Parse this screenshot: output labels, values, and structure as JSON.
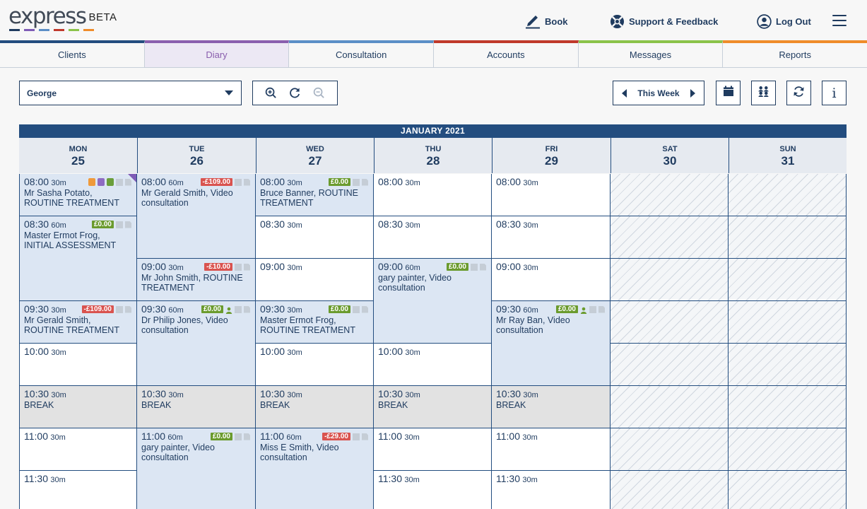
{
  "app": {
    "logo": "express",
    "beta": "BETA",
    "logo_colors": [
      "#1f3b5f",
      "#7e5bb6",
      "#5b8fc7",
      "#c0392b",
      "#8bc34a",
      "#ef8c2a"
    ]
  },
  "header": {
    "book": "Book",
    "support": "Support & Feedback",
    "logout": "Log Out"
  },
  "tabs": [
    {
      "label": "Clients",
      "color": "#234d7f"
    },
    {
      "label": "Diary",
      "color": "#8a5fae"
    },
    {
      "label": "Consultation",
      "color": "#5b8fc7"
    },
    {
      "label": "Accounts",
      "color": "#c0392b"
    },
    {
      "label": "Messages",
      "color": "#8bc34a"
    },
    {
      "label": "Reports",
      "color": "#ef8c2a"
    }
  ],
  "toolbar": {
    "practitioner": "George",
    "week_label": "This Week"
  },
  "calendar": {
    "month": "JANUARY 2021",
    "days": [
      {
        "dow": "MON",
        "num": "25"
      },
      {
        "dow": "TUE",
        "num": "26"
      },
      {
        "dow": "WED",
        "num": "27"
      },
      {
        "dow": "THU",
        "num": "28"
      },
      {
        "dow": "FRI",
        "num": "29"
      },
      {
        "dow": "SAT",
        "num": "30"
      },
      {
        "dow": "SUN",
        "num": "31"
      }
    ],
    "appointments": [
      {
        "day": 0,
        "time": "08:00",
        "dur": "30m",
        "desc": "Mr Sasha Potato, ROUTINE TREATMENT",
        "badge": "",
        "badge_color": "",
        "coins": true,
        "person": false,
        "corner": true
      },
      {
        "day": 0,
        "time": "08:30",
        "dur": "60m",
        "desc": "Master Ermot Frog, INITIAL ASSESSMENT",
        "badge": "£0.00",
        "badge_color": "g",
        "coins": false,
        "person": false,
        "corner": false
      },
      {
        "day": 0,
        "time": "09:30",
        "dur": "30m",
        "desc": "Mr Gerald Smith, ROUTINE TREATMENT",
        "badge": "-£109.00",
        "badge_color": "r",
        "coins": false,
        "person": false,
        "corner": false
      },
      {
        "day": 1,
        "time": "08:00",
        "dur": "60m",
        "desc": "Mr Gerald Smith, Video consultation",
        "badge": "-£109.00",
        "badge_color": "r",
        "coins": false,
        "person": false,
        "corner": false
      },
      {
        "day": 1,
        "time": "09:00",
        "dur": "30m",
        "desc": "Mr John Smith, ROUTINE TREATMENT",
        "badge": "-£10.00",
        "badge_color": "r",
        "coins": false,
        "person": false,
        "corner": false
      },
      {
        "day": 1,
        "time": "09:30",
        "dur": "60m",
        "desc": "Dr Philip Jones, Video consultation",
        "badge": "£0.00",
        "badge_color": "g",
        "coins": false,
        "person": true,
        "corner": false
      },
      {
        "day": 1,
        "time": "11:00",
        "dur": "60m",
        "desc": "gary painter, Video consultation",
        "badge": "£0.00",
        "badge_color": "g",
        "coins": false,
        "person": false,
        "corner": false
      },
      {
        "day": 2,
        "time": "08:00",
        "dur": "30m",
        "desc": "Bruce Banner, ROUTINE TREATMENT",
        "badge": "£0.00",
        "badge_color": "g",
        "coins": false,
        "person": false,
        "corner": false
      },
      {
        "day": 2,
        "time": "09:30",
        "dur": "30m",
        "desc": "Master Ermot Frog, ROUTINE TREATMENT",
        "badge": "£0.00",
        "badge_color": "g",
        "coins": false,
        "person": false,
        "corner": false
      },
      {
        "day": 2,
        "time": "11:00",
        "dur": "60m",
        "desc": "Miss E Smith, Video consultation",
        "badge": "-£29.00",
        "badge_color": "r",
        "coins": false,
        "person": false,
        "corner": false
      },
      {
        "day": 3,
        "time": "09:00",
        "dur": "60m",
        "desc": "gary painter, Video consultation",
        "badge": "£0.00",
        "badge_color": "g",
        "coins": false,
        "person": false,
        "corner": false
      },
      {
        "day": 4,
        "time": "09:30",
        "dur": "60m",
        "desc": "Mr Ray Ban, Video consultation",
        "badge": "£0.00",
        "badge_color": "g",
        "coins": false,
        "person": true,
        "corner": false
      }
    ],
    "free_slots": [
      {
        "day": 3,
        "time": "08:00",
        "dur": "30m"
      },
      {
        "day": 4,
        "time": "08:00",
        "dur": "30m"
      },
      {
        "day": 2,
        "time": "08:30",
        "dur": "30m"
      },
      {
        "day": 3,
        "time": "08:30",
        "dur": "30m"
      },
      {
        "day": 4,
        "time": "08:30",
        "dur": "30m"
      },
      {
        "day": 2,
        "time": "09:00",
        "dur": "30m"
      },
      {
        "day": 4,
        "time": "09:00",
        "dur": "30m"
      },
      {
        "day": 0,
        "time": "10:00",
        "dur": "30m"
      },
      {
        "day": 2,
        "time": "10:00",
        "dur": "30m"
      },
      {
        "day": 3,
        "time": "10:00",
        "dur": "30m"
      },
      {
        "day": 0,
        "time": "11:00",
        "dur": "30m"
      },
      {
        "day": 3,
        "time": "11:00",
        "dur": "30m"
      },
      {
        "day": 4,
        "time": "11:00",
        "dur": "30m"
      },
      {
        "day": 0,
        "time": "11:30",
        "dur": "30m"
      },
      {
        "day": 3,
        "time": "11:30",
        "dur": "30m"
      },
      {
        "day": 4,
        "time": "11:30",
        "dur": "30m"
      }
    ],
    "breaks": [
      {
        "day": 0,
        "time": "10:30",
        "dur": "30m",
        "label": "BREAK"
      },
      {
        "day": 1,
        "time": "10:30",
        "dur": "30m",
        "label": "BREAK"
      },
      {
        "day": 2,
        "time": "10:30",
        "dur": "30m",
        "label": "BREAK"
      },
      {
        "day": 3,
        "time": "10:30",
        "dur": "30m",
        "label": "BREAK"
      },
      {
        "day": 4,
        "time": "10:30",
        "dur": "30m",
        "label": "BREAK"
      }
    ]
  }
}
